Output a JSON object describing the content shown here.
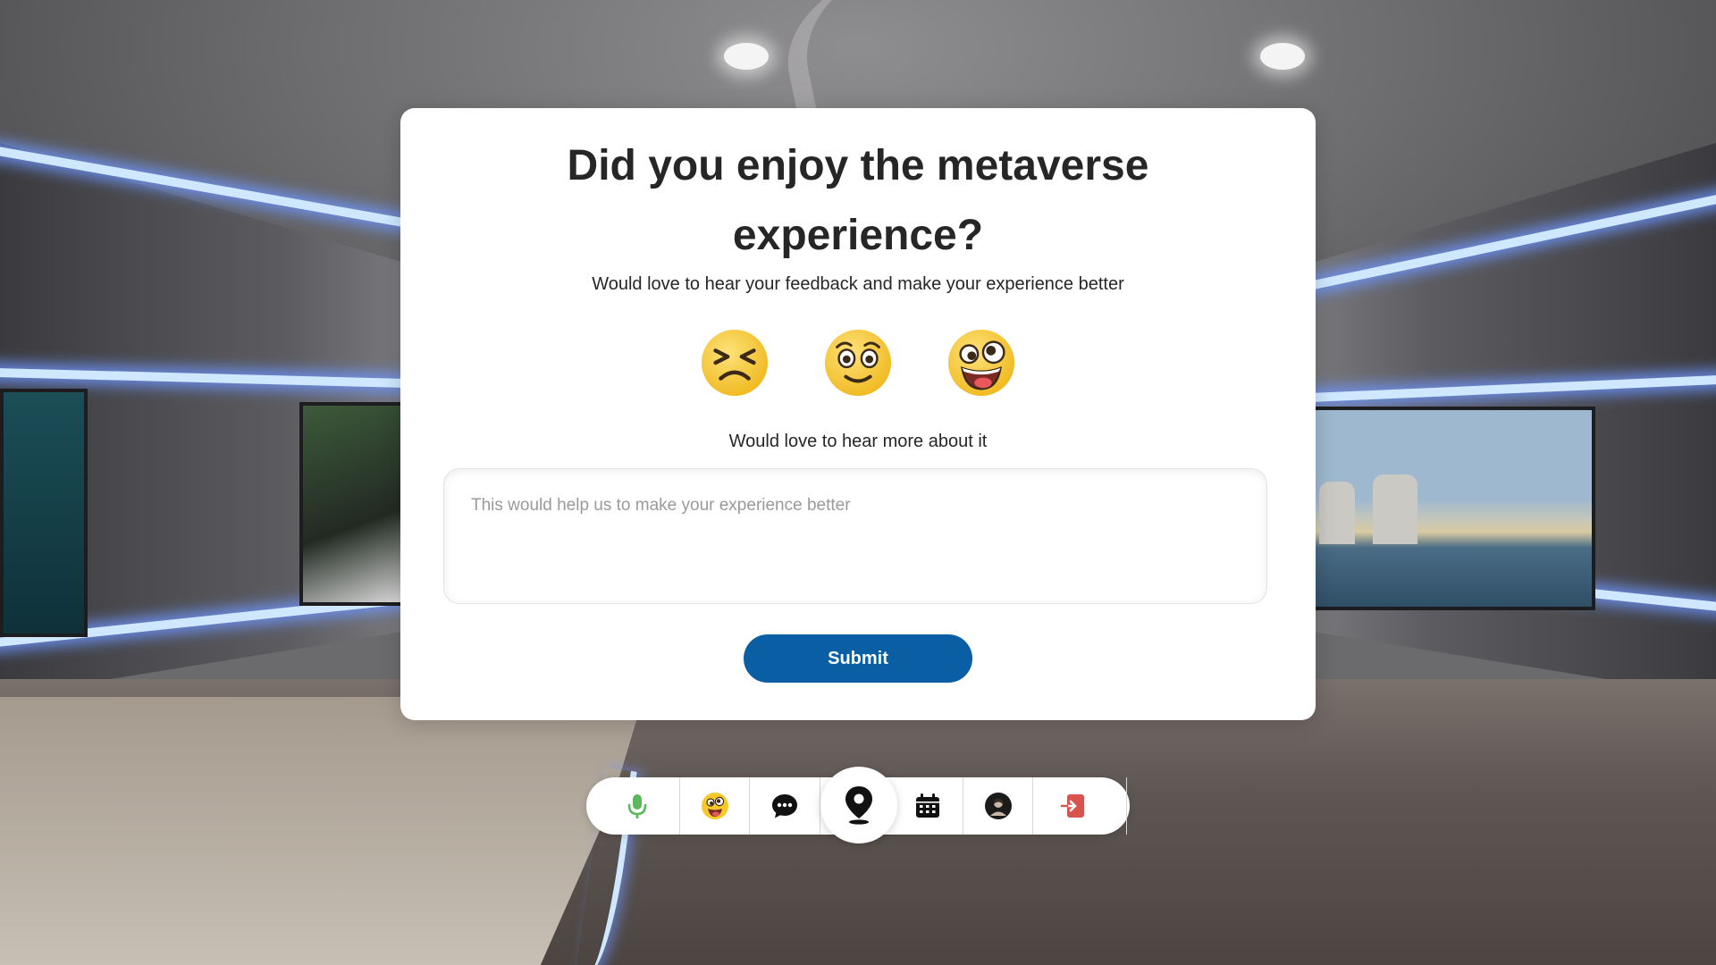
{
  "survey": {
    "title": "Did you enjoy the metaverse experience?",
    "subtitle": "Would love to hear your feedback and make your experience better",
    "ratings": [
      {
        "icon": "confounded-face-icon"
      },
      {
        "icon": "pleading-face-icon"
      },
      {
        "icon": "zany-face-icon"
      }
    ],
    "comment_label": "Would love to hear more about it",
    "comment_placeholder": "This would help us to make your experience better",
    "comment_value": "",
    "submit_label": "Submit"
  },
  "toolbar": {
    "items": [
      {
        "icon": "microphone-icon"
      },
      {
        "icon": "emoji-icon"
      },
      {
        "icon": "chat-icon"
      },
      {
        "icon": "location-pin-icon"
      },
      {
        "icon": "calendar-icon"
      },
      {
        "icon": "avatar-icon"
      },
      {
        "icon": "exit-icon"
      }
    ]
  },
  "colors": {
    "primary": "#0a5fa4",
    "title_text": "#262626",
    "mic": "#5cb85c",
    "exit": "#d9534f",
    "emoji_yellow": "#f7c928"
  }
}
